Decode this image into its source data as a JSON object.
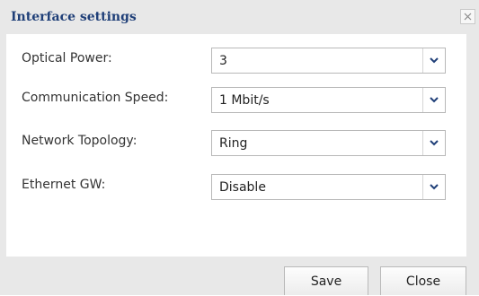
{
  "dialog": {
    "title": "Interface settings"
  },
  "fields": [
    {
      "label": "Optical Power:",
      "value": "3"
    },
    {
      "label": "Communication Speed:",
      "value": "1 Mbit/s"
    },
    {
      "label": "Network Topology:",
      "value": "Ring"
    },
    {
      "label": "Ethernet GW:",
      "value": "Disable"
    }
  ],
  "footer": {
    "save_label": "Save",
    "close_label": "Close"
  },
  "colors": {
    "title": "#1f3f78",
    "panel_gray": "#e8e8e8"
  }
}
